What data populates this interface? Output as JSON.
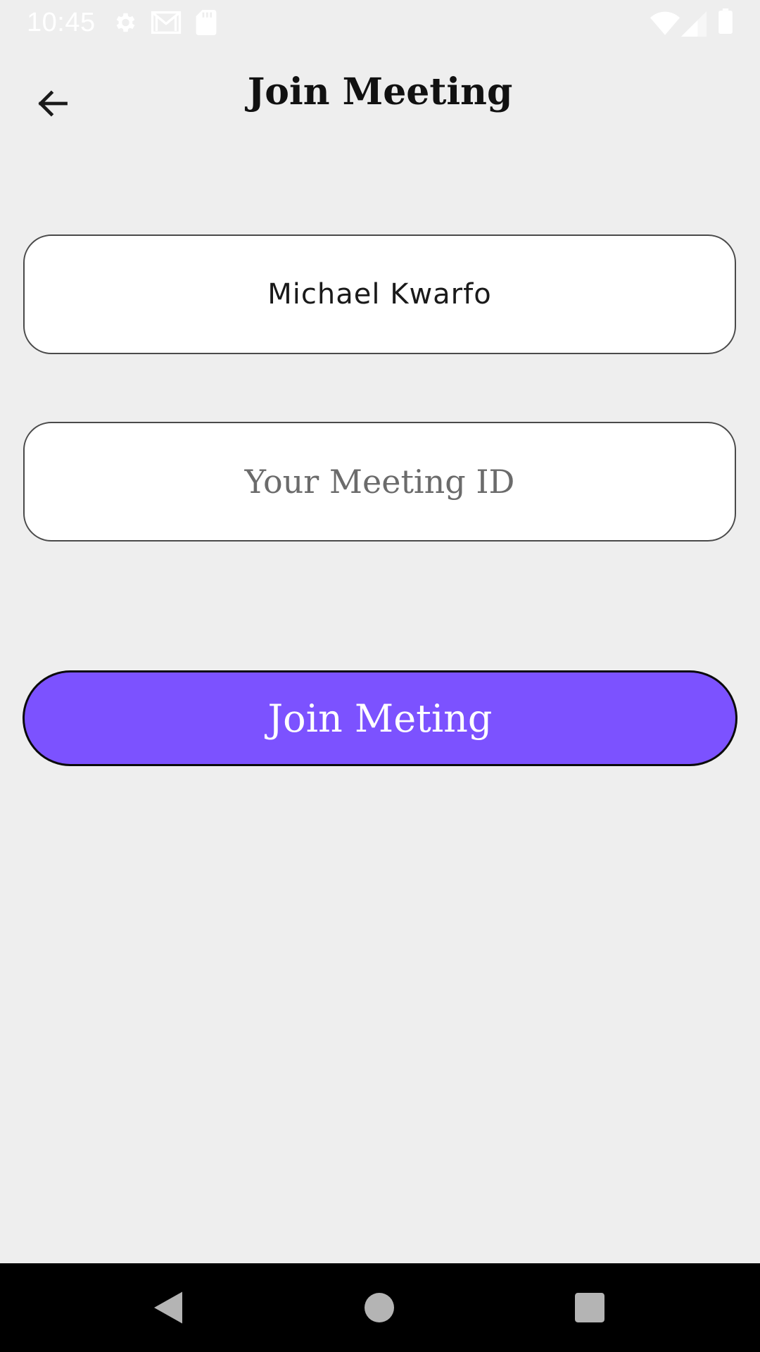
{
  "status_bar": {
    "time": "10:45",
    "icons": [
      "gear-icon",
      "gmail-icon",
      "sd-card-icon",
      "wifi-icon",
      "cellular-signal-icon",
      "battery-icon"
    ]
  },
  "app_bar": {
    "back_icon": "arrow-back-icon",
    "title": "Join Meeting"
  },
  "form": {
    "name_value": "Michael Kwarfo",
    "meeting_id_value": "",
    "meeting_id_placeholder": "Your Meeting ID"
  },
  "join_button": {
    "label": "Join Meting"
  },
  "nav_bar": {
    "icons": [
      "nav-back-icon",
      "nav-home-icon",
      "nav-recents-icon"
    ]
  },
  "colors": {
    "background": "#eeeeee",
    "accent": "#7c52ff",
    "field_border": "#4a4a4a",
    "nav_bar": "#000000"
  }
}
